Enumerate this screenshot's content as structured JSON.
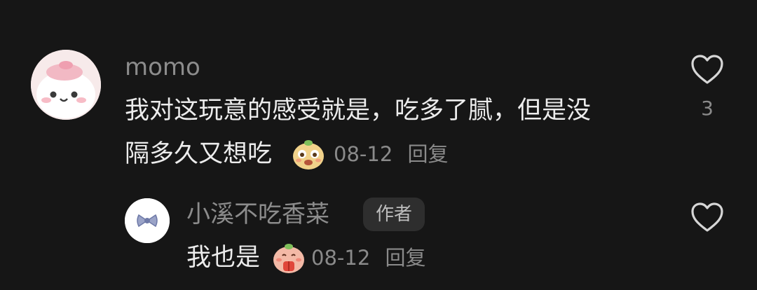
{
  "comment": {
    "username": "momo",
    "text_line1": "我对这玩意的感受就是，吃多了腻，但是没",
    "text_line2": "隔多久又想吃",
    "date": "08-12",
    "reply_label": "回复",
    "like_count": "3",
    "emoji_icon": "smiling-face-emoji",
    "avatar_icon": "pink-cartoon-avatar"
  },
  "reply": {
    "username": "小溪不吃香菜",
    "badge": "作者",
    "text": "我也是",
    "date": "08-12",
    "reply_label": "回复",
    "emoji_icon": "praying-hands-emoji",
    "avatar_icon": "bow-avatar"
  },
  "colors": {
    "background": "#161616",
    "username": "#8c8c8c",
    "body_text": "#ececec",
    "meta_text": "#8a8a8a",
    "badge_bg": "#2e2e2e"
  }
}
